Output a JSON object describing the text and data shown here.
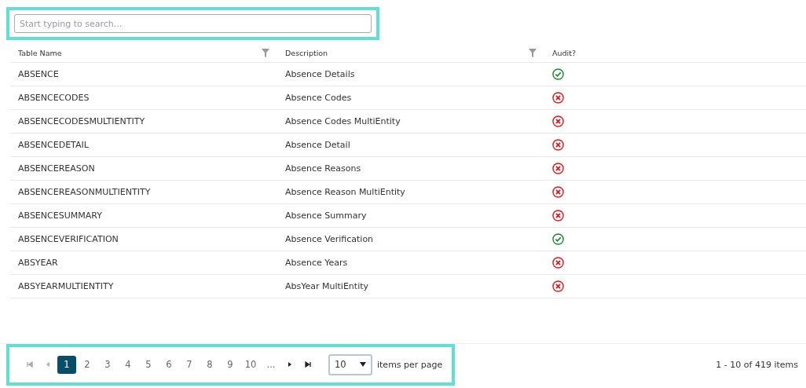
{
  "search": {
    "placeholder": "Start typing to search..."
  },
  "table": {
    "columns": [
      {
        "label": "Table Name",
        "filter": true
      },
      {
        "label": "Description",
        "filter": true
      },
      {
        "label": "Audit?",
        "filter": false
      }
    ],
    "rows": [
      {
        "name": "ABSENCE",
        "description": "Absence Details",
        "audit": true
      },
      {
        "name": "ABSENCECODES",
        "description": "Absence Codes",
        "audit": false
      },
      {
        "name": "ABSENCECODESMULTIENTITY",
        "description": "Absence Codes MultiEntity",
        "audit": false
      },
      {
        "name": "ABSENCEDETAIL",
        "description": "Absence Detail",
        "audit": false
      },
      {
        "name": "ABSENCEREASON",
        "description": "Absence Reasons",
        "audit": false
      },
      {
        "name": "ABSENCEREASONMULTIENTITY",
        "description": "Absence Reason MultiEntity",
        "audit": false
      },
      {
        "name": "ABSENCESUMMARY",
        "description": "Absence Summary",
        "audit": false
      },
      {
        "name": "ABSENCEVERIFICATION",
        "description": "Absence Verification",
        "audit": true
      },
      {
        "name": "ABSYEAR",
        "description": "Absence Years",
        "audit": false
      },
      {
        "name": "ABSYEARMULTIENTITY",
        "description": "AbsYear MultiEntity",
        "audit": false
      }
    ]
  },
  "pager": {
    "first_disabled": true,
    "prev_disabled": true,
    "next_disabled": false,
    "last_disabled": false,
    "pages": [
      {
        "label": "1",
        "selected": true
      },
      {
        "label": "2",
        "selected": false
      },
      {
        "label": "3",
        "selected": false
      },
      {
        "label": "4",
        "selected": false
      },
      {
        "label": "5",
        "selected": false
      },
      {
        "label": "6",
        "selected": false
      },
      {
        "label": "7",
        "selected": false
      },
      {
        "label": "8",
        "selected": false
      },
      {
        "label": "9",
        "selected": false
      },
      {
        "label": "10",
        "selected": false
      },
      {
        "label": "...",
        "selected": false
      }
    ],
    "page_size": "10",
    "page_size_label": "items per page",
    "summary": "1 - 10 of 419 items"
  }
}
